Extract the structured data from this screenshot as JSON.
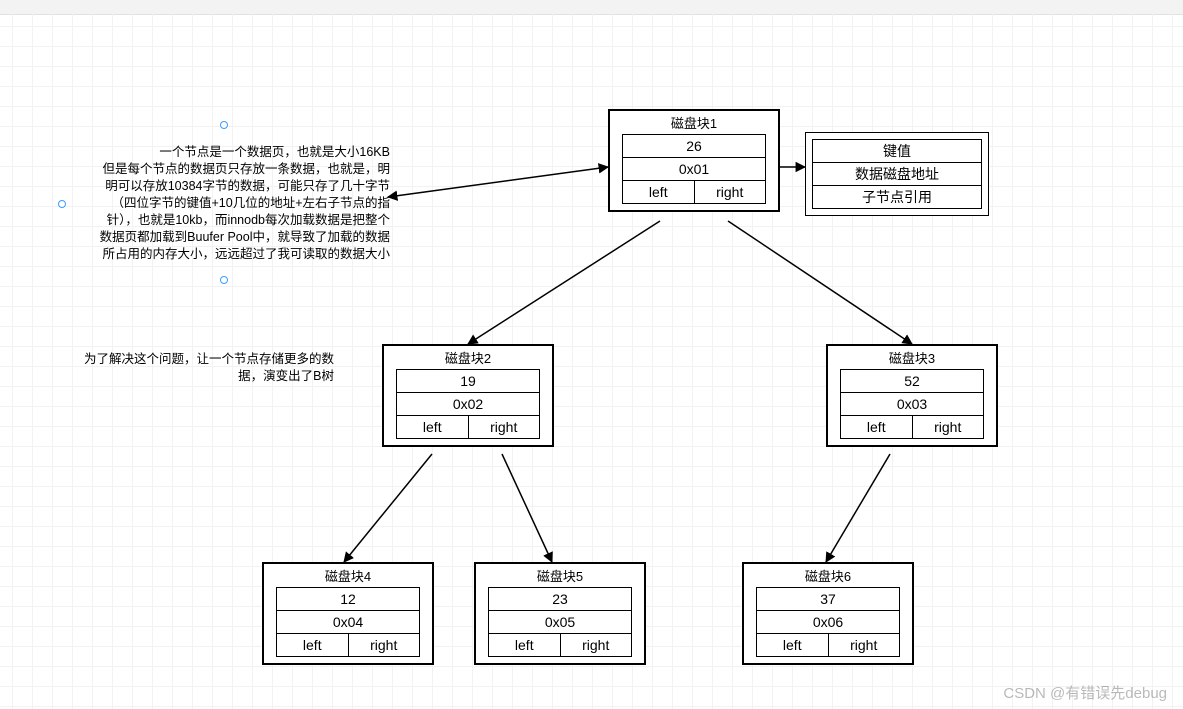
{
  "notes": {
    "note1": "一个节点是一个数据页，也就是大小16KB\n但是每个节点的数据页只存放一条数据，也就是，明\n明可以存放10384字节的数据，可能只存了几十字节\n（四位字节的键值+10几位的地址+左右子节点的指\n针），也就是10kb，而innodb每次加载数据是把整个\n数据页都加载到Buufer Pool中，就导致了加载的数据\n所占用的内存大小，远远超过了我可读取的数据大小",
    "note2": "为了解决这个问题，让一个节点存储更多的数\n据，演变出了B树"
  },
  "legend": {
    "r1": "键值",
    "r2": "数据磁盘地址",
    "r3": "子节点引用"
  },
  "blocks": {
    "b1": {
      "title": "磁盘块1",
      "v1": "26",
      "v2": "0x01",
      "left": "left",
      "right": "right"
    },
    "b2": {
      "title": "磁盘块2",
      "v1": "19",
      "v2": "0x02",
      "left": "left",
      "right": "right"
    },
    "b3": {
      "title": "磁盘块3",
      "v1": "52",
      "v2": "0x03",
      "left": "left",
      "right": "right"
    },
    "b4": {
      "title": "磁盘块4",
      "v1": "12",
      "v2": "0x04",
      "left": "left",
      "right": "right"
    },
    "b5": {
      "title": "磁盘块5",
      "v1": "23",
      "v2": "0x05",
      "left": "left",
      "right": "right"
    },
    "b6": {
      "title": "磁盘块6",
      "v1": "37",
      "v2": "0x06",
      "left": "left",
      "right": "right"
    }
  },
  "watermark": "CSDN @有错误先debug",
  "chart_data": {
    "type": "diagram-tree",
    "description": "Binary-tree style disk-block index diagram (precursor to B-tree) — each node is a disk block storing a key, a data address, and left/right child pointers.",
    "nodes": [
      {
        "id": "b1",
        "label": "磁盘块1",
        "key": 26,
        "addr": "0x01",
        "left": "b2",
        "right": "b3"
      },
      {
        "id": "b2",
        "label": "磁盘块2",
        "key": 19,
        "addr": "0x02",
        "left": "b4",
        "right": "b5"
      },
      {
        "id": "b3",
        "label": "磁盘块3",
        "key": 52,
        "addr": "0x03",
        "left": "b6",
        "right": null
      },
      {
        "id": "b4",
        "label": "磁盘块4",
        "key": 12,
        "addr": "0x04",
        "left": null,
        "right": null
      },
      {
        "id": "b5",
        "label": "磁盘块5",
        "key": 23,
        "addr": "0x05",
        "left": null,
        "right": null
      },
      {
        "id": "b6",
        "label": "磁盘块6",
        "key": 37,
        "addr": "0x06",
        "left": null,
        "right": null
      }
    ],
    "legend_fields": [
      "键值",
      "数据磁盘地址",
      "子节点引用"
    ],
    "annotations": [
      "一个节点是一个数据页，也就是大小16KB；但是每个节点的数据页只存放一条数据……导致加载的数据所占用的内存大小，远远超过了我可读取的数据大小",
      "为了解决这个问题，让一个节点存储更多的数据，演变出了B树"
    ]
  }
}
